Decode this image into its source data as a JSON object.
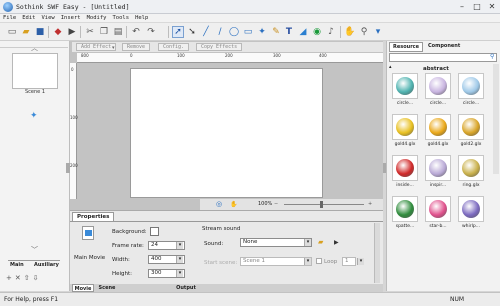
{
  "window": {
    "title": "Sothink SWF Easy - [Untitled]",
    "minimize": "–",
    "maximize": "□",
    "close": "✕"
  },
  "menu": [
    "File",
    "Edit",
    "View",
    "Insert",
    "Modify",
    "Tools",
    "Help"
  ],
  "effects_bar": {
    "add_effect": "Add Effect",
    "remove": "Remove",
    "config": "Config.",
    "copy_effects": "Copy Effects"
  },
  "ruler_h_labels": [
    "800",
    "0",
    "100",
    "200",
    "300",
    "400"
  ],
  "ruler_v_labels": [
    "0",
    "100",
    "200"
  ],
  "left_panel": {
    "scene_label": "Scene 1",
    "tabs": [
      "Main",
      "Auxiliary"
    ]
  },
  "canvas_status": {
    "zoom": "100%"
  },
  "properties": {
    "tab": "Properties",
    "movie_label": "Main Movie",
    "background_label": "Background:",
    "frame_rate_label": "Frame rate:",
    "frame_rate_value": "24",
    "width_label": "Width:",
    "width_value": "400",
    "height_label": "Height:",
    "height_value": "300",
    "stream_sound_label": "Stream sound",
    "sound_label": "Sound:",
    "sound_value": "None",
    "start_scene_label": "Start scene:",
    "start_scene_value": "Scene 1",
    "loop_label": "Loop",
    "loop_count": "1"
  },
  "bottom_tabs": [
    "Movie",
    "Scene",
    "Output"
  ],
  "right_panel": {
    "tabs": [
      "Resource",
      "Component"
    ],
    "category": "abstract",
    "items": [
      {
        "label": "circle...",
        "color": "#4fb3b0"
      },
      {
        "label": "circle...",
        "color": "#c8b4e0"
      },
      {
        "label": "circle...",
        "color": "#9fc9e8"
      },
      {
        "label": "gold4.glx",
        "color": "#e8c020"
      },
      {
        "label": "gold4.glx",
        "color": "#eaa818"
      },
      {
        "label": "gold2.glx",
        "color": "#d9a528"
      },
      {
        "label": "inside...",
        "color": "#d02828"
      },
      {
        "label": "inspir...",
        "color": "#b9a9d6"
      },
      {
        "label": "ring.glx",
        "color": "#c9b04a"
      },
      {
        "label": "spatte...",
        "color": "#2f8c3c"
      },
      {
        "label": "star-b...",
        "color": "#e0508c"
      },
      {
        "label": "whirlp...",
        "color": "#7c6ac0"
      }
    ]
  },
  "status": {
    "help": "For Help, press F1",
    "num": "NUM"
  }
}
